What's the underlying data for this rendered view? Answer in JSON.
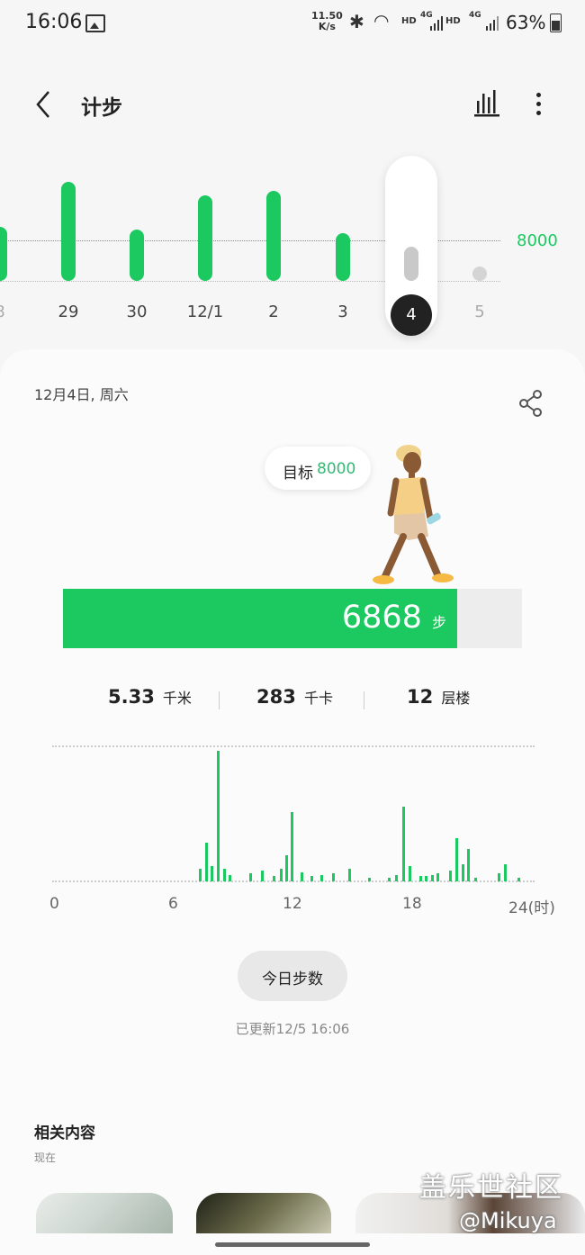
{
  "status_bar": {
    "time": "16:06",
    "speed_value": "11.50",
    "speed_unit": "K/s",
    "hd_1": "HD",
    "net_1": "4G",
    "hd_2": "HD",
    "net_2": "4G",
    "battery": "63%"
  },
  "header": {
    "title": "计步"
  },
  "week_chart": {
    "goal_label": "8000",
    "days": [
      {
        "label": "8",
        "steps_fraction": 0.55
      },
      {
        "label": "29",
        "steps_fraction": 1.0
      },
      {
        "label": "30",
        "steps_fraction": 0.52
      },
      {
        "label": "12/1",
        "steps_fraction": 0.86
      },
      {
        "label": "2",
        "steps_fraction": 0.91
      },
      {
        "label": "3",
        "steps_fraction": 0.48
      },
      {
        "label": "4",
        "steps_fraction": 0.35,
        "selected": true
      },
      {
        "label": "5",
        "steps_fraction": 0.0
      }
    ]
  },
  "detail": {
    "date": "12月4日, 周六",
    "goal_prefix": "目标",
    "goal_value": "8000",
    "steps_value": "6868",
    "steps_unit": "步",
    "progress_fraction": 0.858,
    "stats": [
      {
        "value": "5.33",
        "unit": "千米"
      },
      {
        "value": "283",
        "unit": "千卡"
      },
      {
        "value": "12",
        "unit": "层楼"
      }
    ]
  },
  "hourly_chart": {
    "x_labels": [
      "0",
      "6",
      "12",
      "18",
      "24(时)"
    ],
    "bars": [
      {
        "hour": 7.45,
        "level": 0.1
      },
      {
        "hour": 7.75,
        "level": 0.3
      },
      {
        "hour": 8.05,
        "level": 0.12
      },
      {
        "hour": 8.35,
        "level": 1.0
      },
      {
        "hour": 8.65,
        "level": 0.1
      },
      {
        "hour": 8.95,
        "level": 0.05
      },
      {
        "hour": 10.0,
        "level": 0.06
      },
      {
        "hour": 10.6,
        "level": 0.08
      },
      {
        "hour": 11.2,
        "level": 0.04
      },
      {
        "hour": 11.55,
        "level": 0.1
      },
      {
        "hour": 11.8,
        "level": 0.2
      },
      {
        "hour": 12.1,
        "level": 0.53
      },
      {
        "hour": 12.6,
        "level": 0.07
      },
      {
        "hour": 13.1,
        "level": 0.04
      },
      {
        "hour": 13.6,
        "level": 0.05
      },
      {
        "hour": 14.2,
        "level": 0.06
      },
      {
        "hour": 15.0,
        "level": 0.1
      },
      {
        "hour": 16.0,
        "level": 0.03
      },
      {
        "hour": 17.0,
        "level": 0.03
      },
      {
        "hour": 17.4,
        "level": 0.05
      },
      {
        "hour": 17.75,
        "level": 0.57
      },
      {
        "hour": 18.05,
        "level": 0.12
      },
      {
        "hour": 18.6,
        "level": 0.04
      },
      {
        "hour": 18.9,
        "level": 0.04
      },
      {
        "hour": 19.2,
        "level": 0.05
      },
      {
        "hour": 19.5,
        "level": 0.06
      },
      {
        "hour": 20.1,
        "level": 0.08
      },
      {
        "hour": 20.45,
        "level": 0.33
      },
      {
        "hour": 20.75,
        "level": 0.13
      },
      {
        "hour": 21.05,
        "level": 0.25
      },
      {
        "hour": 21.4,
        "level": 0.03
      },
      {
        "hour": 22.6,
        "level": 0.06
      },
      {
        "hour": 22.9,
        "level": 0.13
      },
      {
        "hour": 23.6,
        "level": 0.03
      }
    ]
  },
  "today_button": "今日步数",
  "updated_text": "已更新12/5 16:06",
  "related": {
    "title": "相关内容",
    "subtitle": "现在"
  },
  "watermark": {
    "line1": "盖乐世社区",
    "line2": "@Mikuya"
  },
  "colors": {
    "accent": "#1bc960",
    "goal_green": "#37b877",
    "selected_day_bg": "#222222",
    "background": "#f6f6f6"
  }
}
